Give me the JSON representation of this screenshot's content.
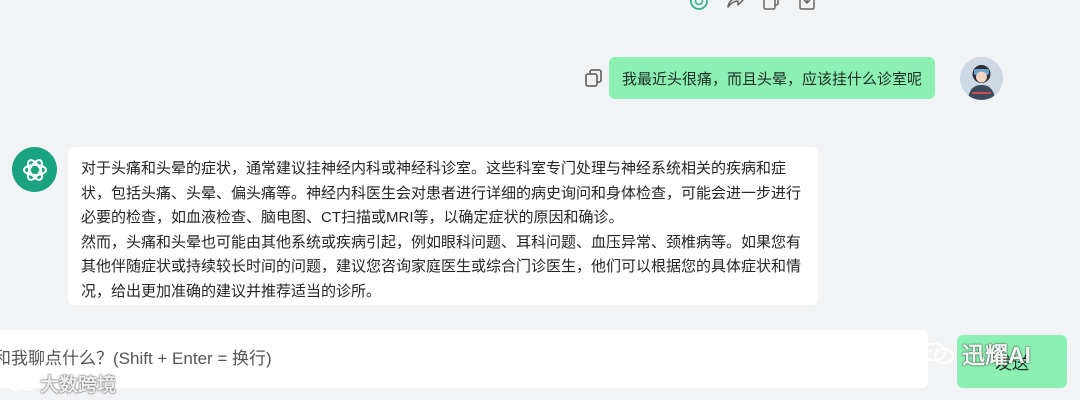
{
  "toolbar": {
    "icons": [
      "openai-icon",
      "share-icon",
      "copy-icon",
      "download-icon"
    ]
  },
  "user_message": {
    "text": "我最近头很痛，而且头晕，应该挂什么诊室呢"
  },
  "assistant_message": {
    "paragraphs": [
      "对于头痛和头晕的症状，通常建议挂神经内科或神经科诊室。这些科室专门处理与神经系统相关的疾病和症状，包括头痛、头晕、偏头痛等。神经内科医生会对患者进行详细的病史询问和身体检查，可能会进一步进行必要的检查，如血液检查、脑电图、CT扫描或MRI等，以确定症状的原因和确诊。",
      "然而，头痛和头晕也可能由其他系统或疾病引起，例如眼科问题、耳科问题、血压异常、颈椎病等。如果您有其他伴随症状或持续较长时间的问题，建议您咨询家庭医生或综合门诊医生，他们可以根据您的具体症状和情况，给出更加准确的建议并推荐适当的诊所。"
    ]
  },
  "input": {
    "placeholder": "和我聊点什么？(Shift + Enter = 换行)",
    "value": ""
  },
  "send_button": {
    "label": "发送"
  },
  "watermarks": {
    "left": "大数跨境",
    "right": "迅耀AI"
  },
  "colors": {
    "accent": "#8bf0b2",
    "bot_avatar": "#19a37f",
    "background": "#f2f3f5"
  }
}
